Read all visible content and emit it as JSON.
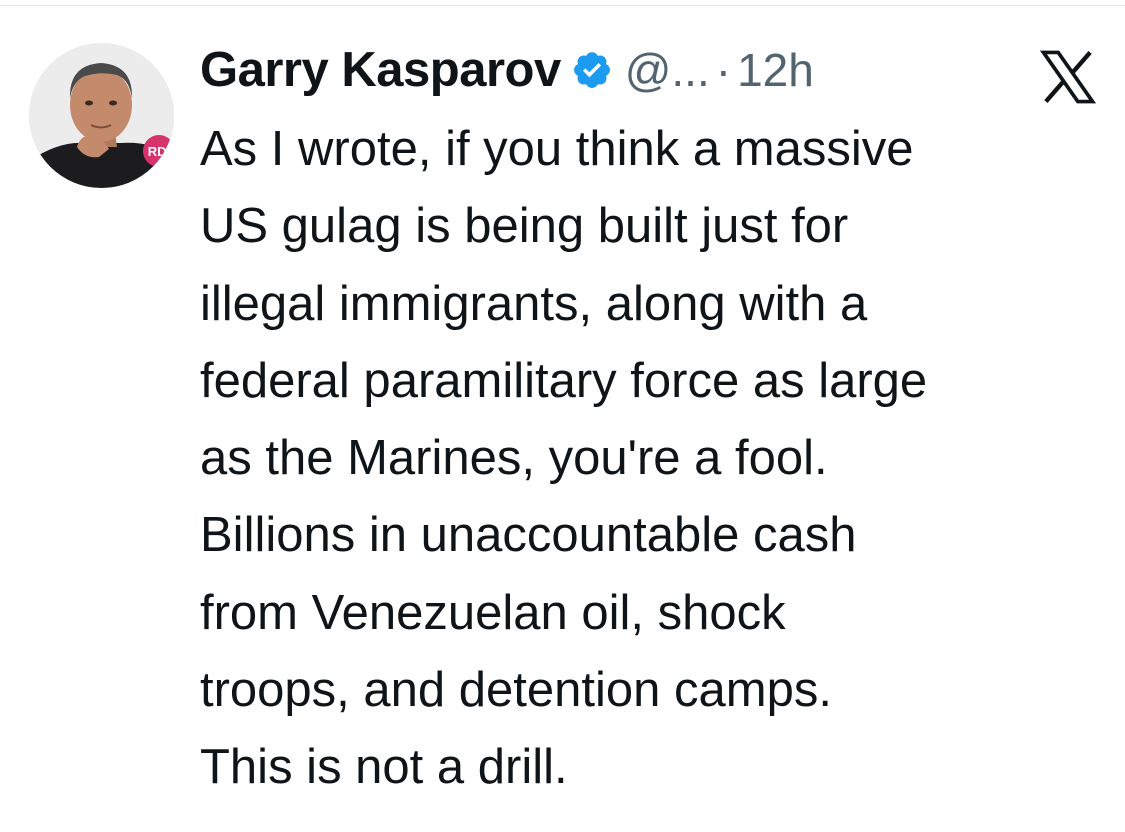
{
  "author": {
    "display_name": "Garry Kasparov",
    "handle": "@...",
    "separator": "·",
    "timestamp": "12h",
    "verified": true,
    "avatar_badge": "RDI"
  },
  "platform_icon": "x-logo-icon",
  "tweet": {
    "lines": [
      "As I wrote, if you think a massive",
      "US gulag is being built just for",
      "illegal immigrants, along with a",
      "federal paramilitary force as large",
      "as the Marines, you're a fool.",
      "Billions in unaccountable cash",
      "from Venezuelan oil, shock",
      "troops, and detention camps.",
      "This is not a drill."
    ]
  },
  "colors": {
    "text": "#0f1419",
    "secondary": "#536471",
    "verified": "#1d9bf0",
    "badge": "#d6336c"
  }
}
